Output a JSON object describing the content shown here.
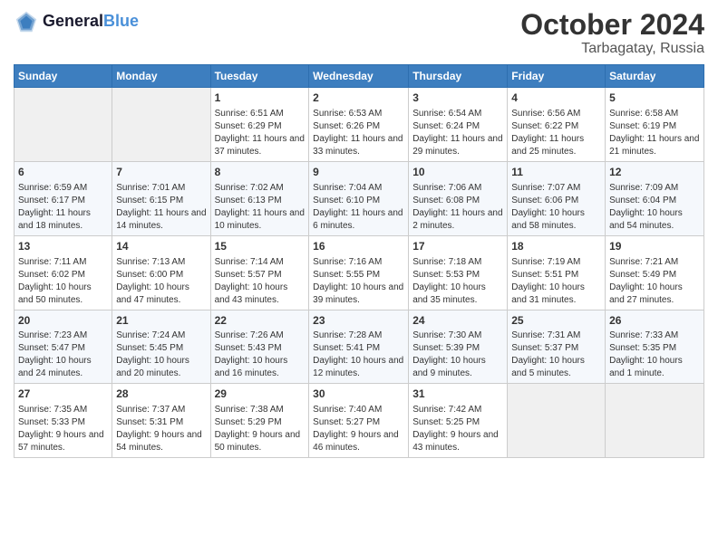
{
  "logo": {
    "line1": "General",
    "line2": "Blue"
  },
  "title": "October 2024",
  "location": "Tarbagatay, Russia",
  "days_of_week": [
    "Sunday",
    "Monday",
    "Tuesday",
    "Wednesday",
    "Thursday",
    "Friday",
    "Saturday"
  ],
  "weeks": [
    [
      {
        "day": "",
        "empty": true
      },
      {
        "day": "",
        "empty": true
      },
      {
        "day": "1",
        "sunrise": "Sunrise: 6:51 AM",
        "sunset": "Sunset: 6:29 PM",
        "daylight": "Daylight: 11 hours and 37 minutes."
      },
      {
        "day": "2",
        "sunrise": "Sunrise: 6:53 AM",
        "sunset": "Sunset: 6:26 PM",
        "daylight": "Daylight: 11 hours and 33 minutes."
      },
      {
        "day": "3",
        "sunrise": "Sunrise: 6:54 AM",
        "sunset": "Sunset: 6:24 PM",
        "daylight": "Daylight: 11 hours and 29 minutes."
      },
      {
        "day": "4",
        "sunrise": "Sunrise: 6:56 AM",
        "sunset": "Sunset: 6:22 PM",
        "daylight": "Daylight: 11 hours and 25 minutes."
      },
      {
        "day": "5",
        "sunrise": "Sunrise: 6:58 AM",
        "sunset": "Sunset: 6:19 PM",
        "daylight": "Daylight: 11 hours and 21 minutes."
      }
    ],
    [
      {
        "day": "6",
        "sunrise": "Sunrise: 6:59 AM",
        "sunset": "Sunset: 6:17 PM",
        "daylight": "Daylight: 11 hours and 18 minutes."
      },
      {
        "day": "7",
        "sunrise": "Sunrise: 7:01 AM",
        "sunset": "Sunset: 6:15 PM",
        "daylight": "Daylight: 11 hours and 14 minutes."
      },
      {
        "day": "8",
        "sunrise": "Sunrise: 7:02 AM",
        "sunset": "Sunset: 6:13 PM",
        "daylight": "Daylight: 11 hours and 10 minutes."
      },
      {
        "day": "9",
        "sunrise": "Sunrise: 7:04 AM",
        "sunset": "Sunset: 6:10 PM",
        "daylight": "Daylight: 11 hours and 6 minutes."
      },
      {
        "day": "10",
        "sunrise": "Sunrise: 7:06 AM",
        "sunset": "Sunset: 6:08 PM",
        "daylight": "Daylight: 11 hours and 2 minutes."
      },
      {
        "day": "11",
        "sunrise": "Sunrise: 7:07 AM",
        "sunset": "Sunset: 6:06 PM",
        "daylight": "Daylight: 10 hours and 58 minutes."
      },
      {
        "day": "12",
        "sunrise": "Sunrise: 7:09 AM",
        "sunset": "Sunset: 6:04 PM",
        "daylight": "Daylight: 10 hours and 54 minutes."
      }
    ],
    [
      {
        "day": "13",
        "sunrise": "Sunrise: 7:11 AM",
        "sunset": "Sunset: 6:02 PM",
        "daylight": "Daylight: 10 hours and 50 minutes."
      },
      {
        "day": "14",
        "sunrise": "Sunrise: 7:13 AM",
        "sunset": "Sunset: 6:00 PM",
        "daylight": "Daylight: 10 hours and 47 minutes."
      },
      {
        "day": "15",
        "sunrise": "Sunrise: 7:14 AM",
        "sunset": "Sunset: 5:57 PM",
        "daylight": "Daylight: 10 hours and 43 minutes."
      },
      {
        "day": "16",
        "sunrise": "Sunrise: 7:16 AM",
        "sunset": "Sunset: 5:55 PM",
        "daylight": "Daylight: 10 hours and 39 minutes."
      },
      {
        "day": "17",
        "sunrise": "Sunrise: 7:18 AM",
        "sunset": "Sunset: 5:53 PM",
        "daylight": "Daylight: 10 hours and 35 minutes."
      },
      {
        "day": "18",
        "sunrise": "Sunrise: 7:19 AM",
        "sunset": "Sunset: 5:51 PM",
        "daylight": "Daylight: 10 hours and 31 minutes."
      },
      {
        "day": "19",
        "sunrise": "Sunrise: 7:21 AM",
        "sunset": "Sunset: 5:49 PM",
        "daylight": "Daylight: 10 hours and 27 minutes."
      }
    ],
    [
      {
        "day": "20",
        "sunrise": "Sunrise: 7:23 AM",
        "sunset": "Sunset: 5:47 PM",
        "daylight": "Daylight: 10 hours and 24 minutes."
      },
      {
        "day": "21",
        "sunrise": "Sunrise: 7:24 AM",
        "sunset": "Sunset: 5:45 PM",
        "daylight": "Daylight: 10 hours and 20 minutes."
      },
      {
        "day": "22",
        "sunrise": "Sunrise: 7:26 AM",
        "sunset": "Sunset: 5:43 PM",
        "daylight": "Daylight: 10 hours and 16 minutes."
      },
      {
        "day": "23",
        "sunrise": "Sunrise: 7:28 AM",
        "sunset": "Sunset: 5:41 PM",
        "daylight": "Daylight: 10 hours and 12 minutes."
      },
      {
        "day": "24",
        "sunrise": "Sunrise: 7:30 AM",
        "sunset": "Sunset: 5:39 PM",
        "daylight": "Daylight: 10 hours and 9 minutes."
      },
      {
        "day": "25",
        "sunrise": "Sunrise: 7:31 AM",
        "sunset": "Sunset: 5:37 PM",
        "daylight": "Daylight: 10 hours and 5 minutes."
      },
      {
        "day": "26",
        "sunrise": "Sunrise: 7:33 AM",
        "sunset": "Sunset: 5:35 PM",
        "daylight": "Daylight: 10 hours and 1 minute."
      }
    ],
    [
      {
        "day": "27",
        "sunrise": "Sunrise: 7:35 AM",
        "sunset": "Sunset: 5:33 PM",
        "daylight": "Daylight: 9 hours and 57 minutes."
      },
      {
        "day": "28",
        "sunrise": "Sunrise: 7:37 AM",
        "sunset": "Sunset: 5:31 PM",
        "daylight": "Daylight: 9 hours and 54 minutes."
      },
      {
        "day": "29",
        "sunrise": "Sunrise: 7:38 AM",
        "sunset": "Sunset: 5:29 PM",
        "daylight": "Daylight: 9 hours and 50 minutes."
      },
      {
        "day": "30",
        "sunrise": "Sunrise: 7:40 AM",
        "sunset": "Sunset: 5:27 PM",
        "daylight": "Daylight: 9 hours and 46 minutes."
      },
      {
        "day": "31",
        "sunrise": "Sunrise: 7:42 AM",
        "sunset": "Sunset: 5:25 PM",
        "daylight": "Daylight: 9 hours and 43 minutes."
      },
      {
        "day": "",
        "empty": true
      },
      {
        "day": "",
        "empty": true
      }
    ]
  ]
}
